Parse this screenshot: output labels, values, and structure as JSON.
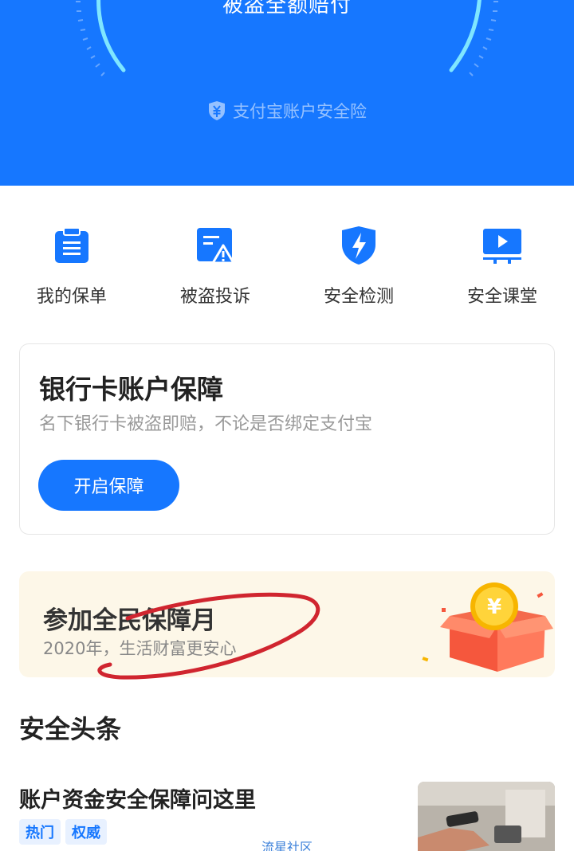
{
  "hero": {
    "title": "被盗全额赔付",
    "subtitle": "支付宝账户安全险",
    "bg_color": "#1677ff"
  },
  "actions": [
    {
      "label": "我的保单",
      "icon": "clipboard-icon"
    },
    {
      "label": "被盗投诉",
      "icon": "report-warning-icon"
    },
    {
      "label": "安全检测",
      "icon": "lightning-shield-icon"
    },
    {
      "label": "安全课堂",
      "icon": "video-screen-icon"
    }
  ],
  "bank_card": {
    "title": "银行卡账户保障",
    "desc": "名下银行卡被盗即赔，不论是否绑定支付宝",
    "button": "开启保障"
  },
  "promo": {
    "title": "参加全民保障月",
    "subtitle": "2020年，生活财富更安心",
    "coin_symbol": "¥",
    "bg_color": "#fdf7e8"
  },
  "news_section": {
    "title": "安全头条",
    "article": {
      "title": "账户资金安全保障问这里",
      "tags": [
        "热门",
        "权威"
      ]
    }
  },
  "watermark": "流星社区",
  "colors": {
    "accent": "#1677ff",
    "scribble": "#d0252f"
  }
}
